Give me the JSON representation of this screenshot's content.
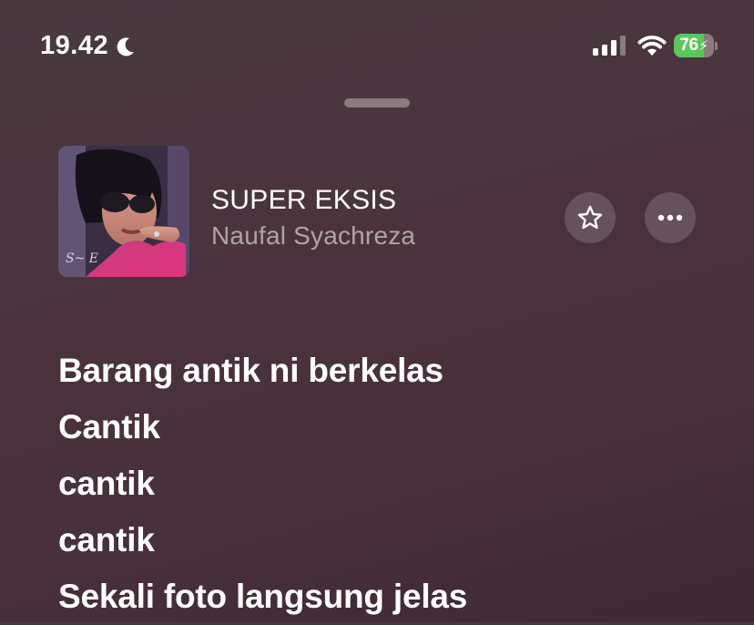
{
  "status_bar": {
    "time": "19.42",
    "battery_level": "76",
    "battery_percent": 76,
    "battery_charging": true,
    "icons": [
      "moon-icon",
      "signal-icon",
      "wifi-icon",
      "battery-icon"
    ]
  },
  "track": {
    "title": "SUPER EKSIS",
    "artist": "Naufal Syachreza",
    "artwork": "album-artwork"
  },
  "actions": {
    "favorite_icon": "star-icon",
    "more_icon": "ellipsis-icon"
  },
  "lyrics": [
    "Barang antik ni berkelas",
    "Cantik",
    "cantik",
    "cantik",
    "Sekali foto langsung jelas"
  ],
  "colors": {
    "background": "#4a333d",
    "battery_fill": "#5ac75a",
    "text": "#ffffff"
  }
}
